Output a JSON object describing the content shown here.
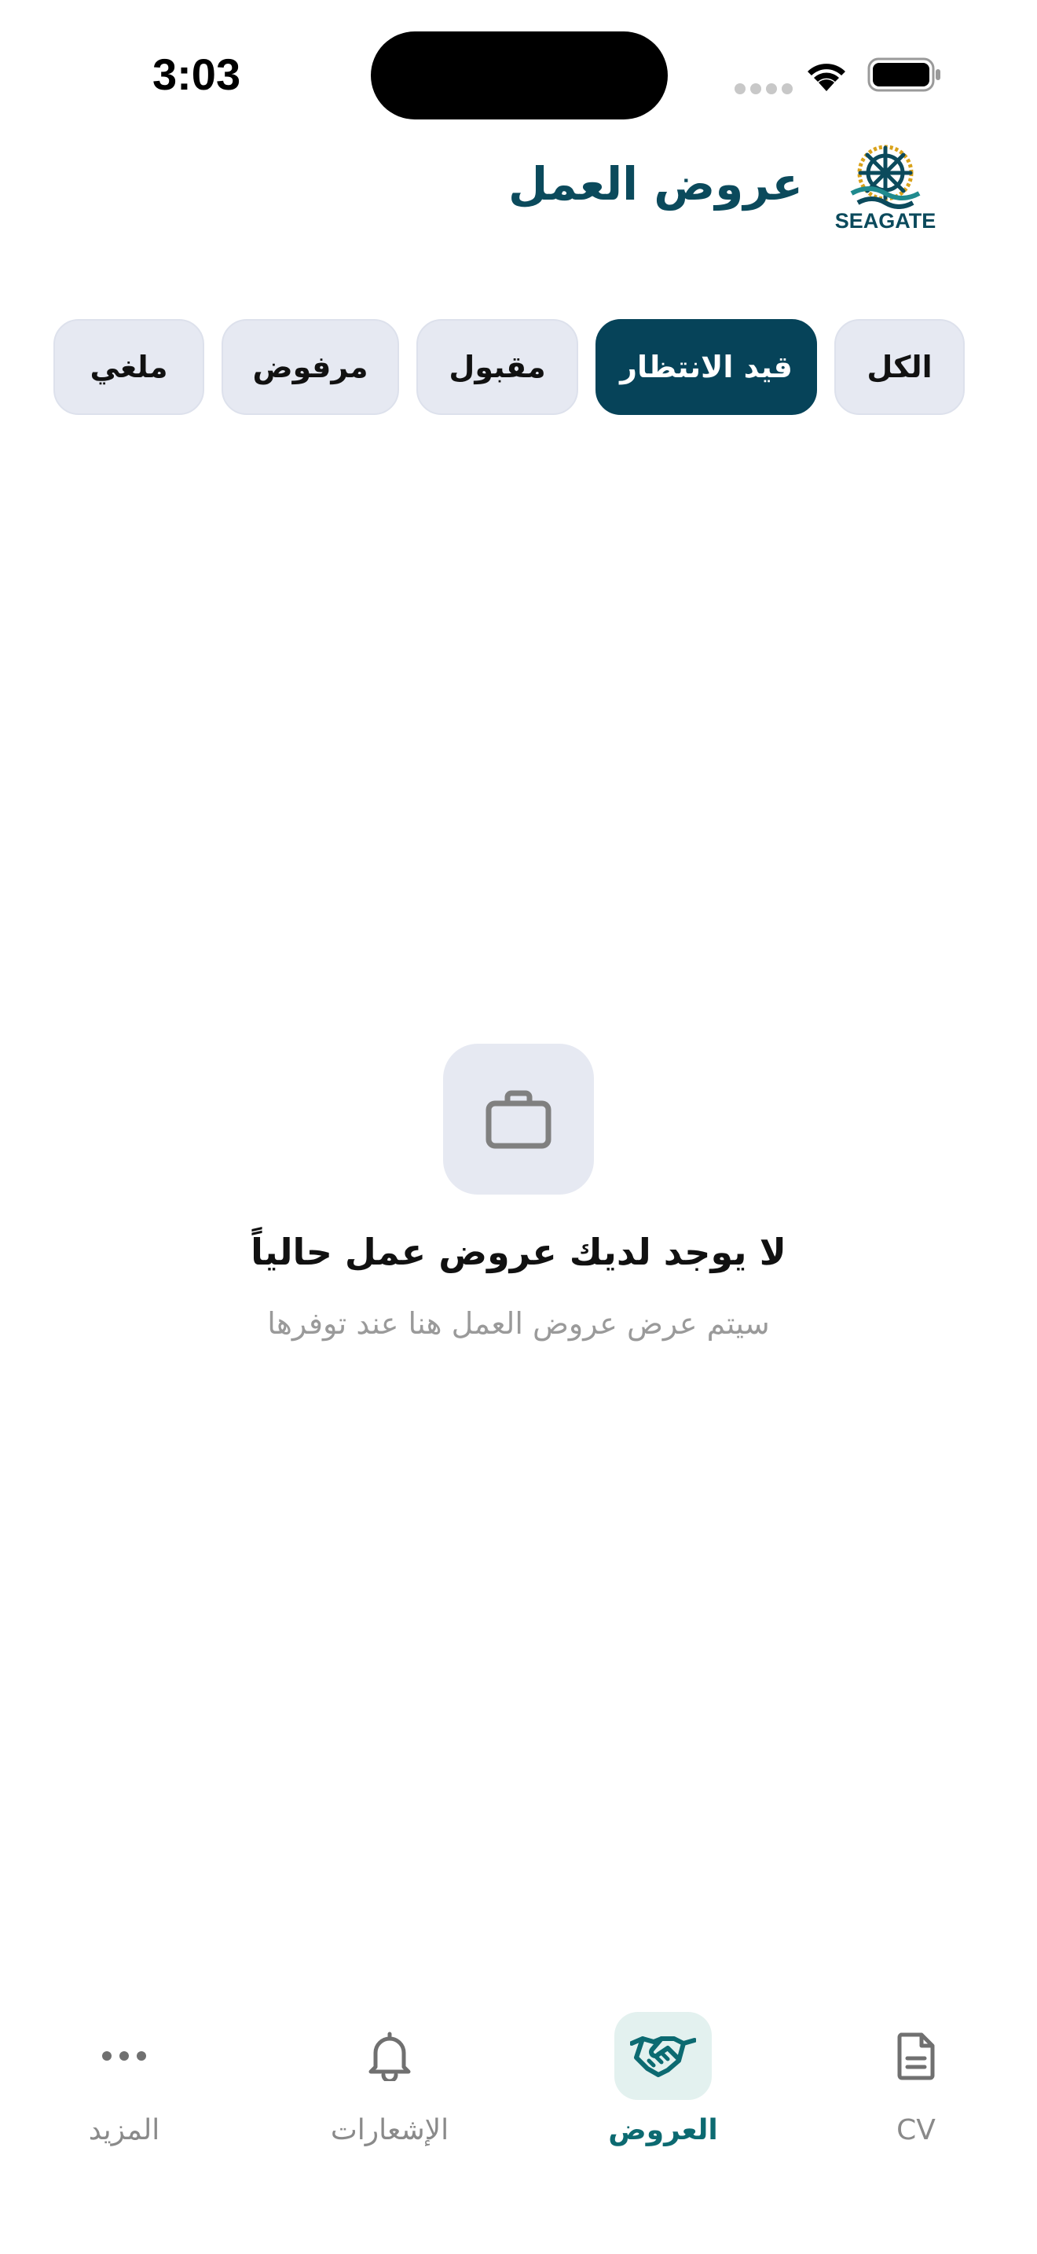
{
  "status_bar": {
    "time": "3:03"
  },
  "header": {
    "title": "عروض العمل",
    "logo_text": "SEAGATE",
    "logo_icon": "ship-wheel-icon"
  },
  "filters": {
    "tabs": [
      {
        "label": "الكل",
        "active": false
      },
      {
        "label": "قيد الانتظار",
        "active": true
      },
      {
        "label": "مقبول",
        "active": false
      },
      {
        "label": "مرفوض",
        "active": false
      },
      {
        "label": "ملغي",
        "active": false
      }
    ]
  },
  "empty_state": {
    "icon": "briefcase-icon",
    "title": "لا يوجد لديك عروض عمل حالياً",
    "subtitle": "سيتم عرض عروض العمل هنا عند توفرها"
  },
  "bottom_nav": {
    "items": [
      {
        "label": "CV",
        "icon": "document-icon",
        "active": false
      },
      {
        "label": "العروض",
        "icon": "handshake-icon",
        "active": true
      },
      {
        "label": "الإشعارات",
        "icon": "bell-icon",
        "active": false
      },
      {
        "label": "المزيد",
        "icon": "more-dots-icon",
        "active": false
      }
    ]
  },
  "colors": {
    "primary": "#064359",
    "title": "#0b4a5c",
    "active_nav": "#0c6a71",
    "chip_bg": "#e6e9f2",
    "muted_text": "#9a9a9a"
  }
}
